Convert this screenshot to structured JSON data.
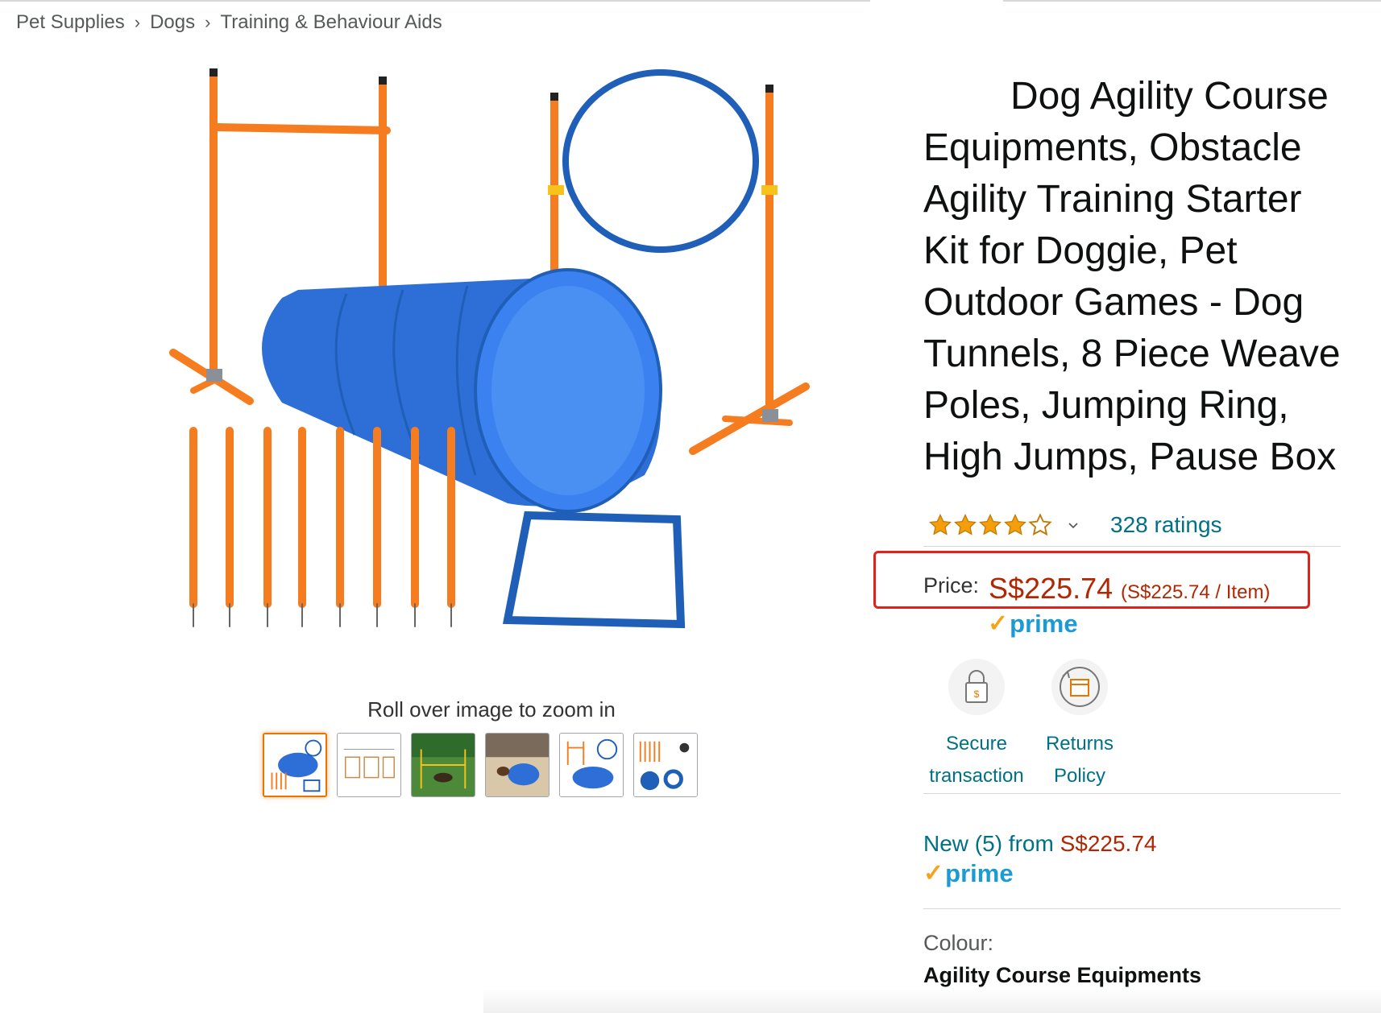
{
  "breadcrumb": [
    "Pet Supplies",
    "Dogs",
    "Training & Behaviour Aids"
  ],
  "breadcrumb_separator": "›",
  "zoom_hint": "Roll over image to zoom in",
  "product": {
    "title": "Dog Agility Course Equipments, Obstacle Agility Training Starter Kit for Doggie, Pet Outdoor Games - Dog Tunnels, 8 Piece Weave Poles, Jumping Ring, High Jumps, Pause Box",
    "rating_stars": 4,
    "rating_max": 5,
    "ratings_text": "328 ratings",
    "price_label": "Price:",
    "price": "S$225.74",
    "price_per_unit": "(S$225.74 / Item)",
    "prime_text": "prime",
    "prime_check": "✓"
  },
  "features": {
    "secure_line1": "Secure",
    "secure_line2": "transaction",
    "returns_line1": "Returns",
    "returns_line2": "Policy"
  },
  "offers": {
    "new_link": "New (5) from ",
    "new_price": "S$225.74",
    "prime_text": "prime"
  },
  "colour": {
    "label": "Colour:",
    "value": "Agility Course Equipments"
  },
  "colors": {
    "link": "#007185",
    "price": "#b12704",
    "highlight_box": "#e0221a",
    "prime_blue": "#1b9bd6",
    "prime_check": "#f7a21b",
    "star": "#f59e0b",
    "equipment_orange": "#f57c1f",
    "equipment_blue": "#2d6fd6"
  }
}
